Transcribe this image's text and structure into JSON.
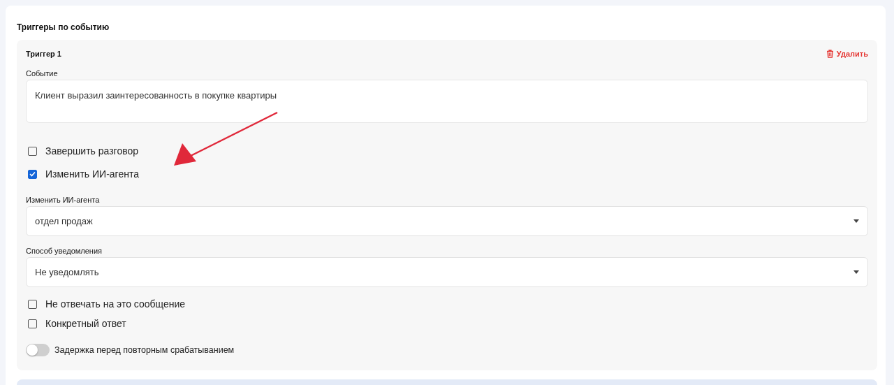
{
  "section": {
    "title": "Триггеры по событию"
  },
  "triggers": [
    {
      "title": "Триггер 1",
      "delete_label": "Удалить",
      "fields": [
        {
          "kind": "textarea",
          "label": "Событие",
          "value": "Клиент выразил заинтересованность в покупке квартиры"
        },
        {
          "kind": "checkbox",
          "label": "Завершить разговор",
          "checked": false
        },
        {
          "kind": "checkbox",
          "label": "Изменить ИИ-агента",
          "checked": true
        },
        {
          "kind": "select",
          "label": "Изменить ИИ-агента",
          "value": "отдел продаж"
        },
        {
          "kind": "select",
          "label": "Способ уведомления",
          "value": "Не уведомлять"
        },
        {
          "kind": "checkbox",
          "label": "Не отвечать на это сообщение",
          "checked": false
        },
        {
          "kind": "checkbox",
          "label": "Конкретный ответ",
          "checked": false
        },
        {
          "kind": "toggle",
          "label": "Задержка перед повторным срабатыванием",
          "on": false
        }
      ]
    }
  ]
}
